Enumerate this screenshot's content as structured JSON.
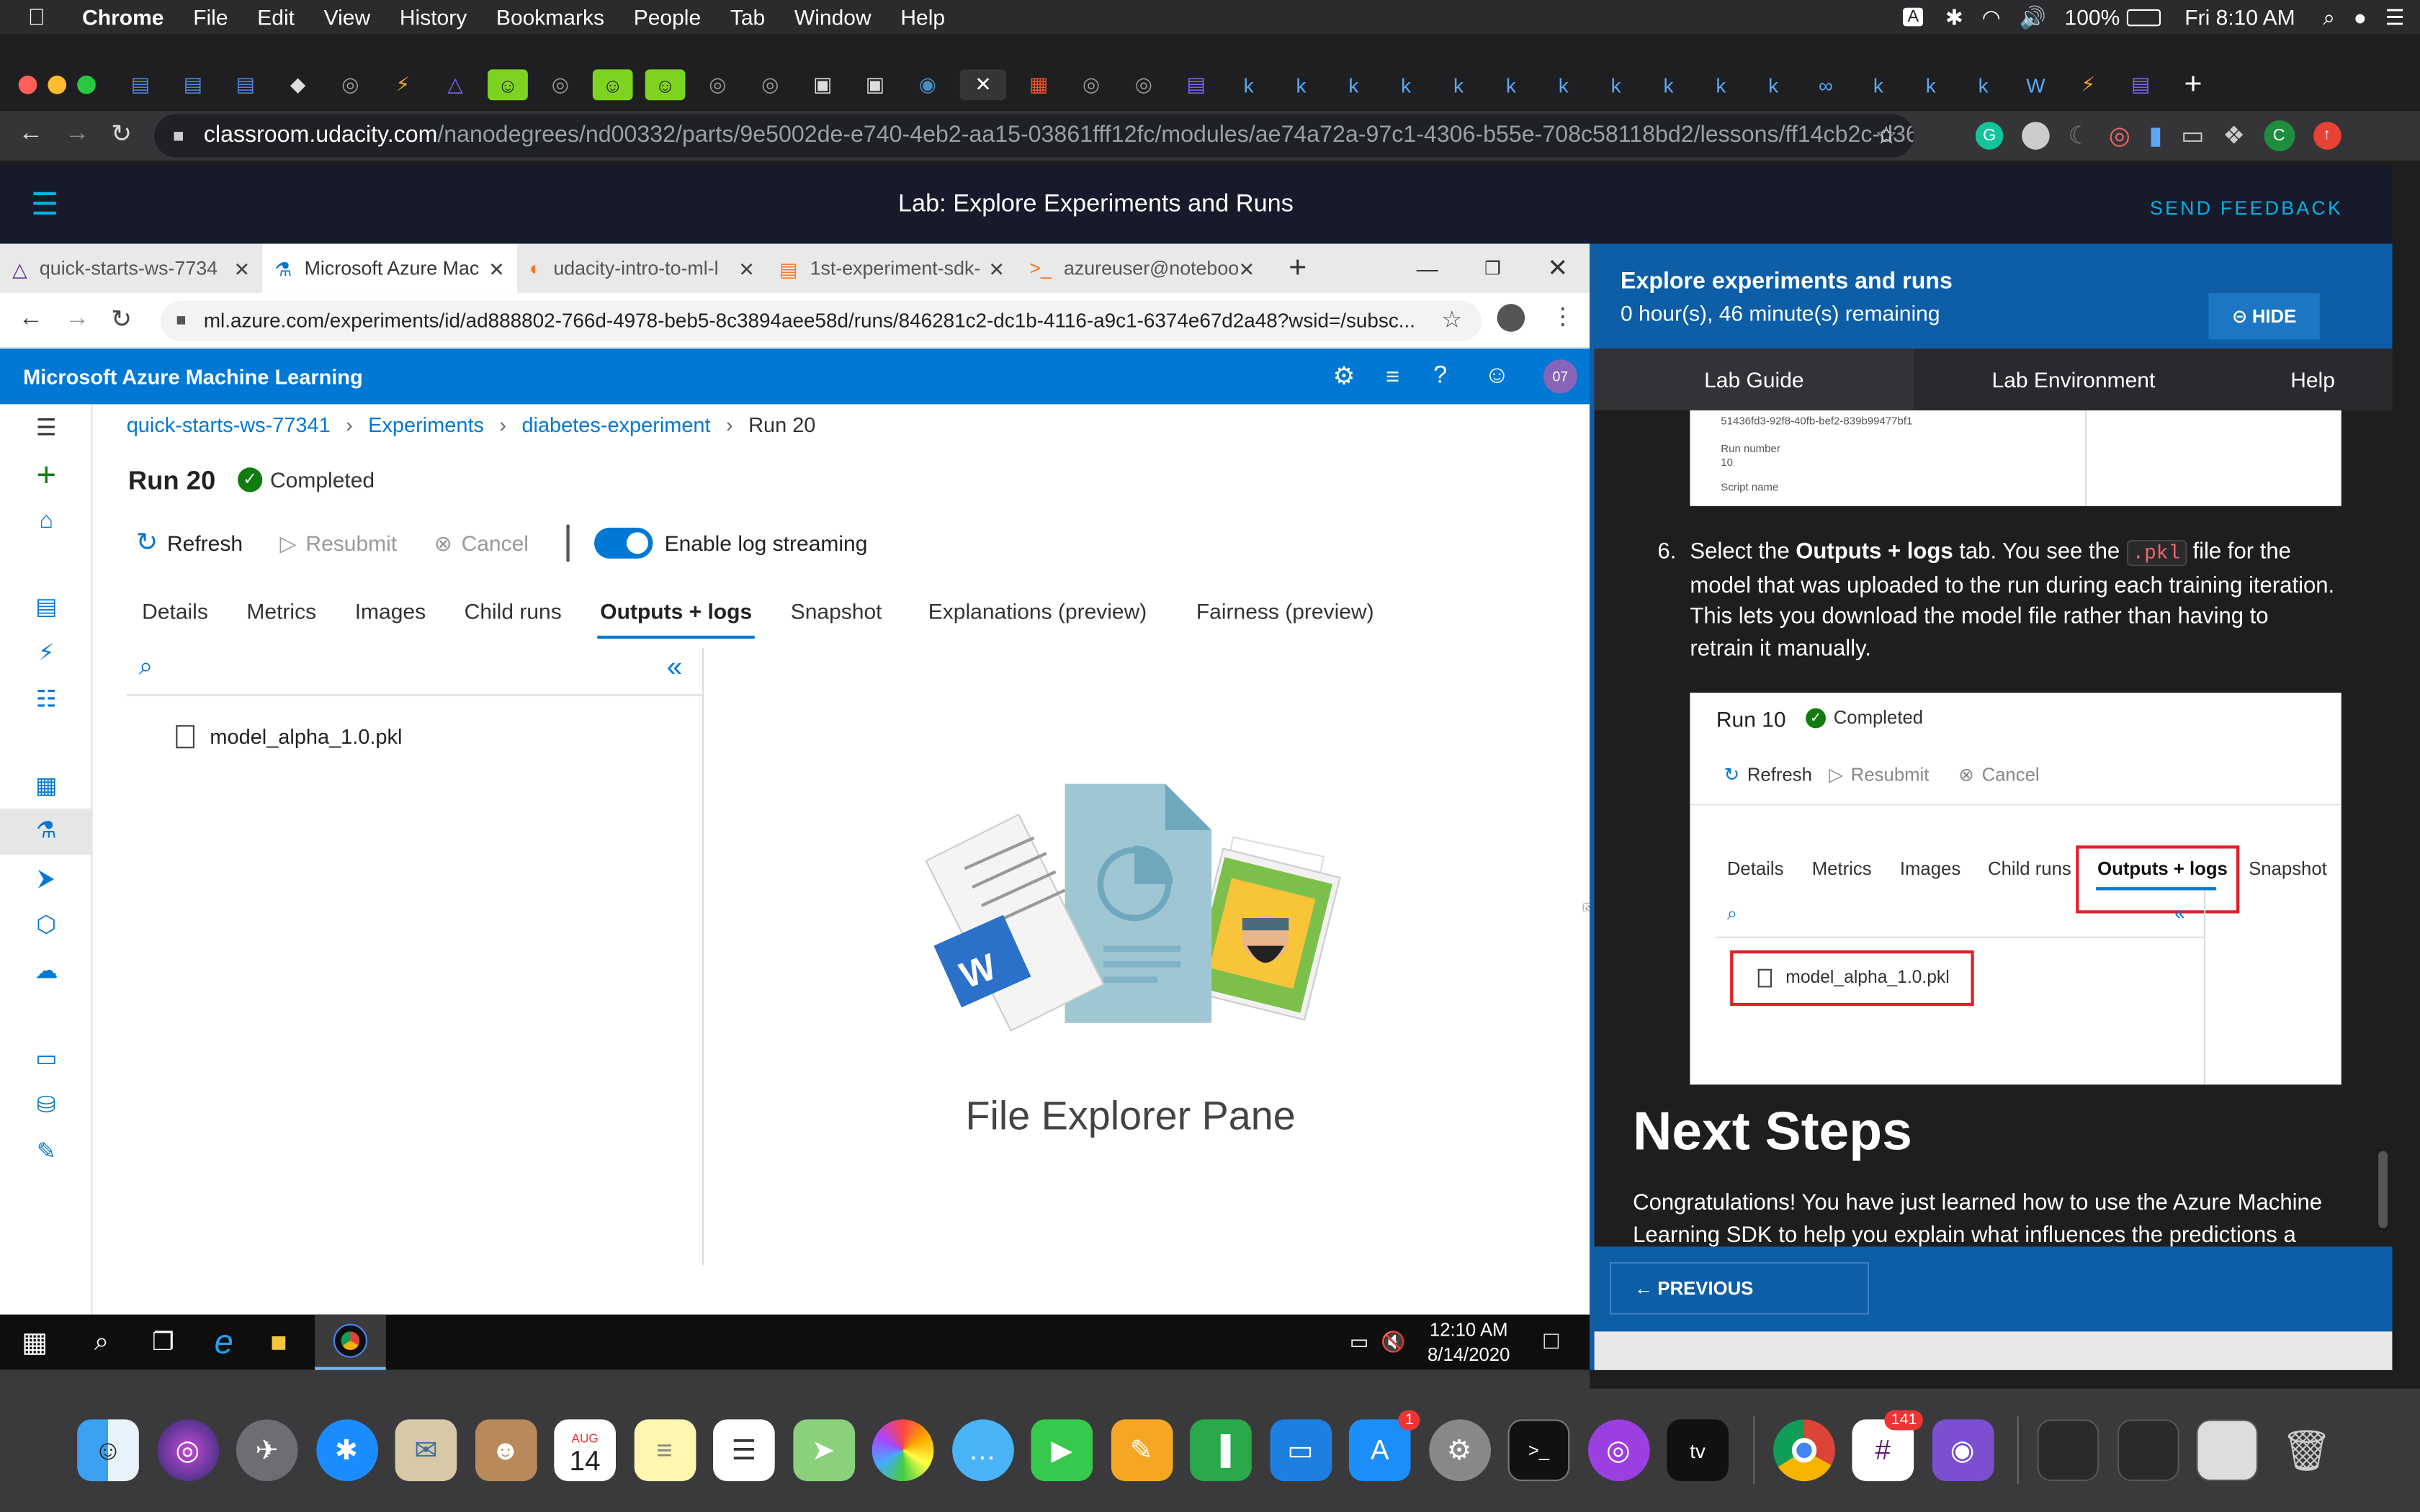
{
  "menubar": {
    "items": [
      "Chrome",
      "File",
      "Edit",
      "View",
      "History",
      "Bookmarks",
      "People",
      "Tab",
      "Window",
      "Help"
    ],
    "battery": "100%",
    "clock": "Fri 8:10 AM",
    "input_source": "A"
  },
  "chrome": {
    "url_host": "classroom.udacity.com",
    "url_path": "/nanodegrees/nd00332/parts/9e5002de-e740-4eb2-aa15-03861fff12fc/modules/ae74a72a-97c1-4306-b55e-708c58118bd2/lessons/ff14cb2c-d36...",
    "profile_initial": "C"
  },
  "udacity": {
    "page_title": "Lab: Explore Experiments and Runs",
    "feedback_label": "SEND FEEDBACK"
  },
  "remote": {
    "edge_tabs": [
      {
        "label": "quick-starts-ws-7734"
      },
      {
        "label": "Microsoft Azure Mac"
      },
      {
        "label": "udacity-intro-to-ml-l"
      },
      {
        "label": "1st-experiment-sdk-"
      },
      {
        "label": "azureuser@noteboo"
      }
    ],
    "url": "ml.azure.com/experiments/id/ad888802-766d-4978-beb5-8c3894aee58d/runs/846281c2-dc1b-4116-a9c1-6374e67d2a48?wsid=/subsc...",
    "app_title": "Microsoft Azure Machine Learning",
    "avatar_initials": "07",
    "breadcrumb": [
      "quick-starts-ws-77341",
      "Experiments",
      "diabetes-experiment",
      "Run 20"
    ],
    "run_title": "Run 20",
    "status": "Completed",
    "actions": {
      "refresh": "Refresh",
      "resubmit": "Resubmit",
      "cancel": "Cancel",
      "log_streaming": "Enable log streaming"
    },
    "tabs": [
      "Details",
      "Metrics",
      "Images",
      "Child runs",
      "Outputs + logs",
      "Snapshot",
      "Explanations (preview)",
      "Fairness (preview)"
    ],
    "active_tab": "Outputs + logs",
    "file": "model_alpha_1.0.pkl",
    "explorer_label": "File Explorer Pane",
    "taskbar_time": "12:10 AM",
    "taskbar_date": "8/14/2020"
  },
  "lab": {
    "title": "Explore experiments and runs",
    "remaining": "0 hour(s), 46 minute(s) remaining",
    "hide_label": "HIDE",
    "tabs": [
      "Lab Guide",
      "Lab Environment",
      "Help"
    ],
    "snippet": {
      "run_id": "51436fd3-92f8-40fb-bef2-839b99477bf1",
      "run_number_label": "Run number",
      "run_number": "10",
      "script_name_label": "Script name"
    },
    "step_number": "6.",
    "step_pre": "Select the ",
    "step_bold": "Outputs + logs",
    "step_mid": " tab. You see the ",
    "step_code": ".pkl",
    "step_post": " file for the model that was uploaded to the run during each training iteration. This lets you download the model file rather than having to retrain it manually.",
    "shot": {
      "run_title": "Run 10",
      "status": "Completed",
      "refresh": "Refresh",
      "resubmit": "Resubmit",
      "cancel": "Cancel",
      "tabs": [
        "Details",
        "Metrics",
        "Images",
        "Child runs",
        "Outputs + logs",
        "Snapshot"
      ],
      "file": "model_alpha_1.0.pkl"
    },
    "next_steps_heading": "Next Steps",
    "next_steps_text": "Congratulations! You have just learned how to use the Azure Machine Learning SDK to help you explain what influences the predictions a",
    "previous_label": "PREVIOUS"
  },
  "dock": {
    "calendar_month": "AUG",
    "calendar_day": "14",
    "appstore_badge": "1",
    "slack_badge": "141"
  }
}
